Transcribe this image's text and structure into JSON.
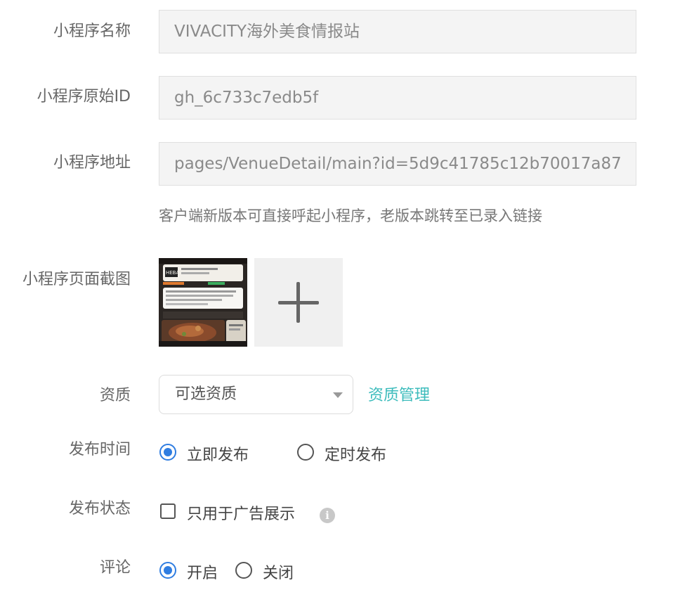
{
  "labels": {
    "name": "小程序名称",
    "original_id": "小程序原始ID",
    "address": "小程序地址",
    "screenshot": "小程序页面截图",
    "qualification": "资质",
    "publish_time": "发布时间",
    "publish_status": "发布状态",
    "comments": "评论"
  },
  "fields": {
    "name_value": "VIVACITY海外美食情报站",
    "original_id_value": "gh_6c733c7edb5f",
    "address_value": "pages/VenueDetail/main?id=5d9c41785c12b70017a87"
  },
  "hint": "客户端新版本可直接呼起小程序，老版本跳转至已录入链接",
  "screenshot": {
    "thumb_logo": "HEBA"
  },
  "qualification": {
    "selected": "可选资质",
    "manage_link": "资质管理"
  },
  "publish_time": {
    "options": [
      "立即发布",
      "定时发布"
    ],
    "selected": "立即发布"
  },
  "publish_status": {
    "checkbox_label": "只用于广告展示",
    "checked": false,
    "info_icon": "info-icon"
  },
  "comments": {
    "options": [
      "开启",
      "关闭"
    ],
    "selected": "开启"
  },
  "colors": {
    "accent_blue": "#2f7de1",
    "link_teal": "#3dbcbc",
    "field_bg": "#f4f4f4"
  }
}
